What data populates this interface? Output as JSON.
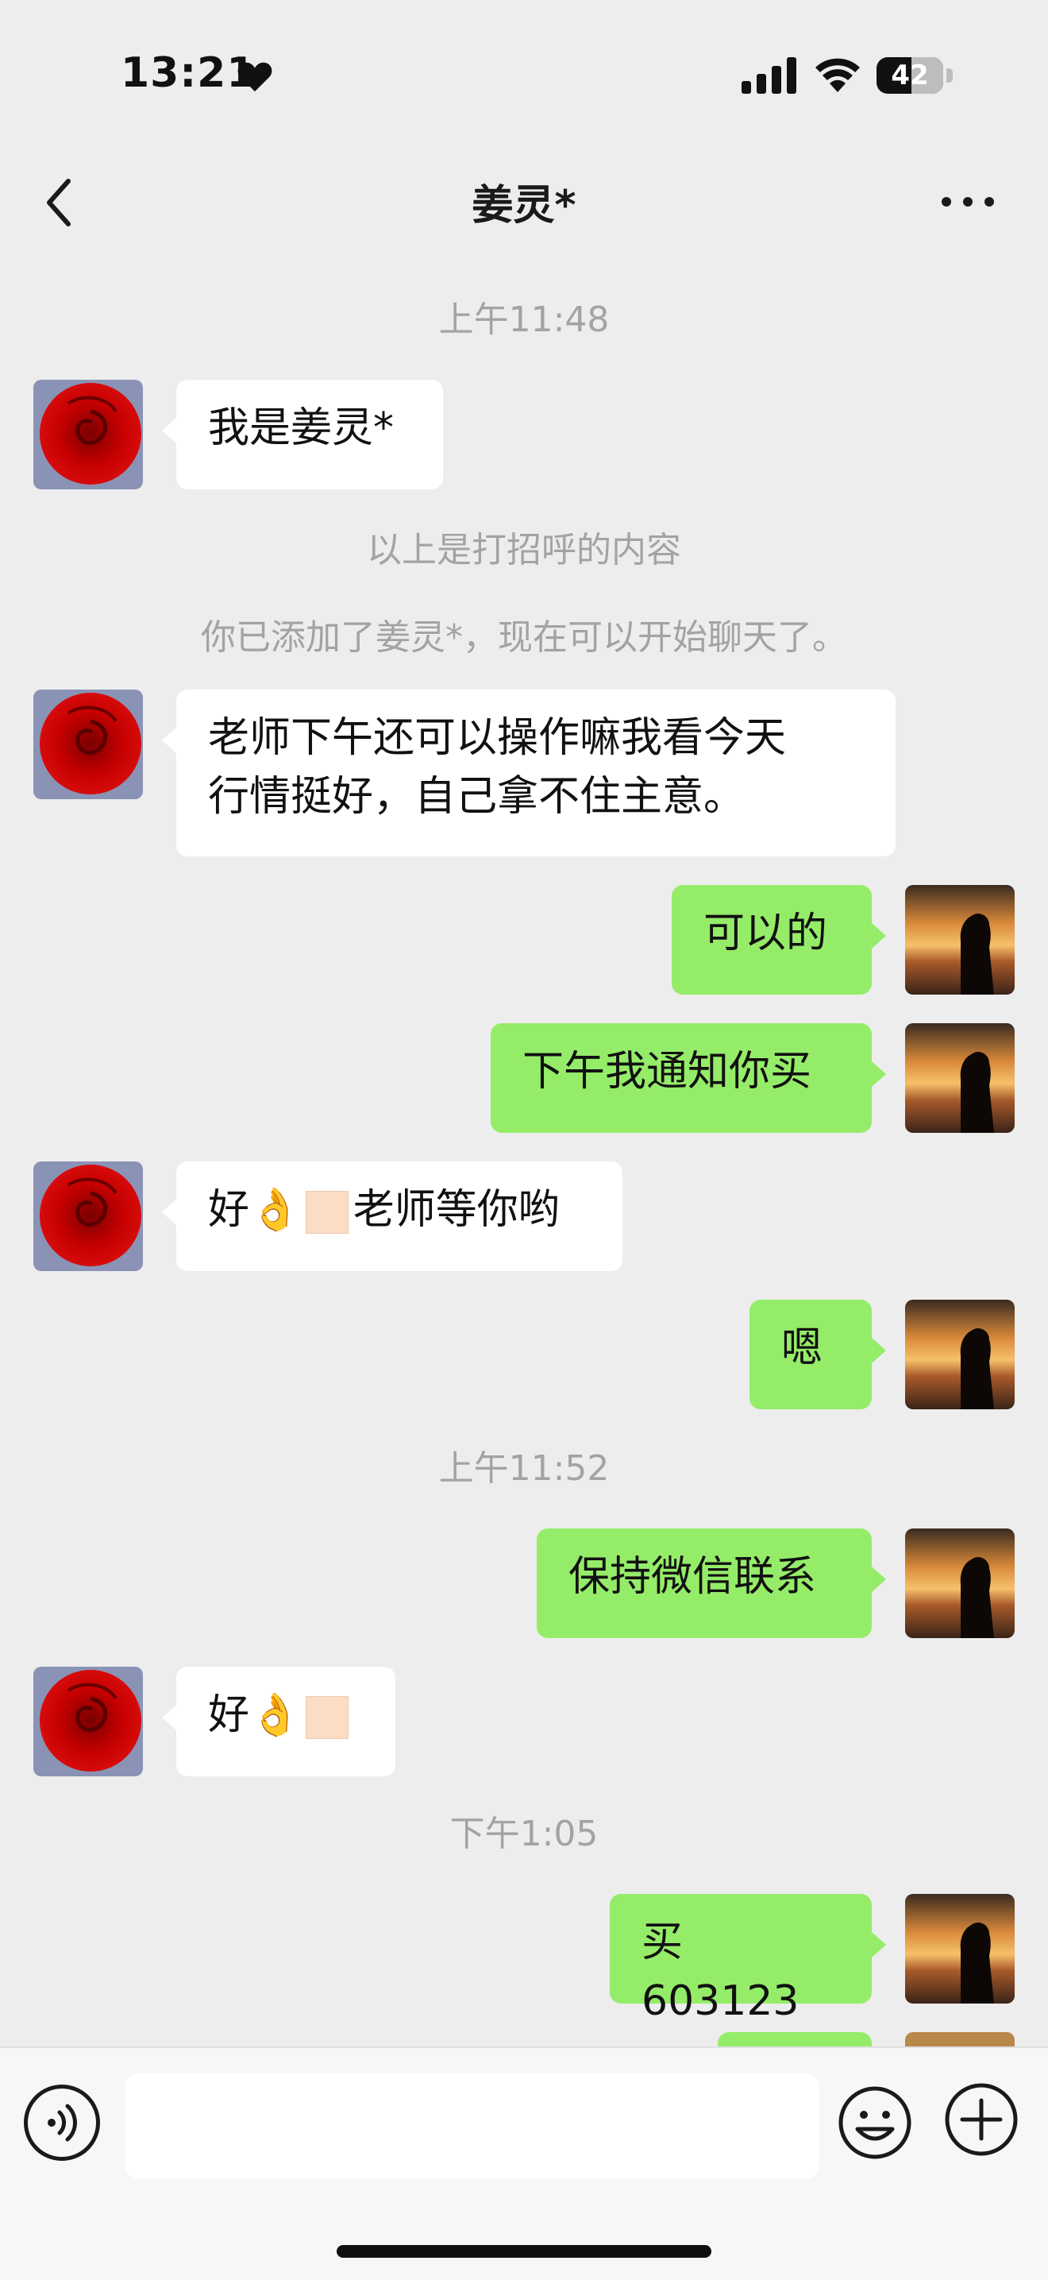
{
  "status_bar": {
    "time": "13:21",
    "battery": "42"
  },
  "nav": {
    "title": "姜灵*"
  },
  "messages": {
    "ts1": "上午11:48",
    "m1": "我是姜灵*",
    "sys1": "以上是打招呼的内容",
    "sys2": "你已添加了姜灵*，现在可以开始聊天了。",
    "m2_line1": "老师下午还可以操作嘛我看今天",
    "m2_line2": "行情挺好，自己拿不住主意。",
    "m3": "可以的",
    "m4": "下午我通知你买",
    "m5_pre": "好👌",
    "m5_post": "老师等你哟",
    "m6": "嗯",
    "ts2": "上午11:52",
    "m7": "保持微信联系",
    "m8_pre": "好👌",
    "ts3": "下午1:05",
    "m9": "买603123"
  },
  "colors": {
    "bubble_out": "#95ec69",
    "bubble_in": "#ffffff",
    "background": "#ededed"
  },
  "icons": {
    "back": "chevron-left-icon",
    "more": "more-dots-icon",
    "voice": "voice-icon",
    "emoji": "emoji-icon",
    "plus": "plus-icon"
  }
}
